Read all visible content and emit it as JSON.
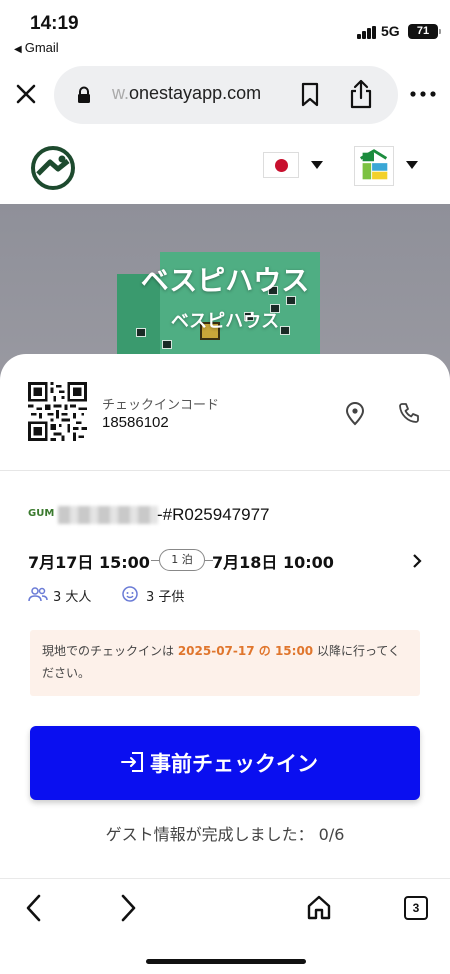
{
  "status_bar": {
    "time": "14:19",
    "back_app": "Gmail",
    "network": "5G",
    "battery": "71"
  },
  "browser": {
    "url_faded": "w.",
    "url_domain": "onestayapp.com",
    "icons": [
      "close-icon",
      "lock-icon",
      "bookmark-icon",
      "share-icon",
      "more-icon"
    ]
  },
  "header": {
    "language_flag": "jp-flag",
    "accent_color": "#0a0ff0"
  },
  "hero": {
    "title": "ベスピハウス",
    "subtitle": "ベスピハウス"
  },
  "card": {
    "checkin_code_label": "チェックインコード",
    "checkin_code_value": "18586102",
    "reservation_logo": "GUM",
    "reservation_number": "-#R025947977",
    "date_from": "7月17日 15:00",
    "nights": "1 泊",
    "date_to": "7月18日 10:00",
    "adults": "3 大人",
    "children": "3 子供",
    "notice_pre": "現地でのチェックインは ",
    "notice_highlight": "2025-07-17 の 15:00",
    "notice_post": " 以降に行ってください。",
    "checkin_button": "事前チェックイン",
    "progress": "ゲスト情報が完成しました： 0/6"
  },
  "bottom_nav": {
    "tab_count": "3"
  }
}
